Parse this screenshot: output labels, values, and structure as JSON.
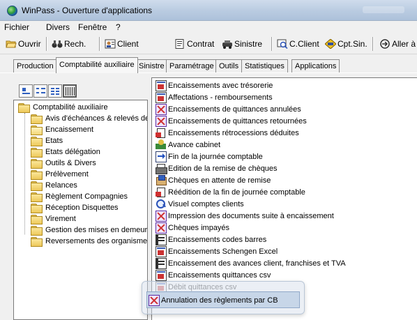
{
  "window": {
    "title": "WinPass - Ouverture d'applications"
  },
  "menu": {
    "items": [
      "Fichier",
      "Divers",
      "Fenêtre",
      "?"
    ]
  },
  "toolbar": {
    "buttons": [
      {
        "label": "Ouvrir",
        "icon": "open-folder-icon"
      },
      {
        "label": "Rech.",
        "icon": "binoculars-icon"
      },
      {
        "label": "Client",
        "icon": "client-icon"
      },
      {
        "label": "Contrat",
        "icon": "contract-icon"
      },
      {
        "label": "Sinistre",
        "icon": "claim-icon"
      },
      {
        "label": "C.Client",
        "icon": "account-client-icon"
      },
      {
        "label": "Cpt.Sin.",
        "icon": "claim-account-icon"
      },
      {
        "label": "Aller à",
        "icon": "goto-icon"
      }
    ]
  },
  "tabs": {
    "items": [
      "Production",
      "Comptabilité auxiliaire",
      "Sinistre",
      "Paramétrage",
      "Outils",
      "Statistiques",
      "Applications"
    ],
    "active": "Comptabilité auxiliaire"
  },
  "tree": {
    "root": "Comptabilité auxiliaire",
    "children": [
      "Avis d'échéances & relevés de",
      "Encaissement",
      "Etats",
      "Etats délégation",
      "Outils & Divers",
      "Prélèvement",
      "Relances",
      "Règlement Compagnies",
      "Réception Disquettes",
      "Virement",
      "Gestion des mises en demeure",
      "Reversements des organismes"
    ],
    "open_item": "Encaissement"
  },
  "list": {
    "items": [
      {
        "label": "Encaissements avec trésorerie",
        "icon": "frame-icon"
      },
      {
        "label": "Affectations - remboursements",
        "icon": "frame-icon"
      },
      {
        "label": "Encaissements de quittances annulées",
        "icon": "cancel-cross-icon"
      },
      {
        "label": "Encaissements de quittances retournées",
        "icon": "cancel-cross-icon"
      },
      {
        "label": "Encaissements rétrocessions déduites",
        "icon": "document-red-icon"
      },
      {
        "label": "Avance cabinet",
        "icon": "landscape-icon"
      },
      {
        "label": "Fin de la journée comptable",
        "icon": "arrow-icon"
      },
      {
        "label": "Edition de la remise de chèques",
        "icon": "printer-icon"
      },
      {
        "label": "Chèques en attente de remise",
        "icon": "stack-icon"
      },
      {
        "label": "Réédition de la fin de journée comptable",
        "icon": "document-red-icon"
      },
      {
        "label": "Visuel comptes clients",
        "icon": "magnifier-icon"
      },
      {
        "label": "Impression des documents suite à encaissement",
        "icon": "cancel-cross-icon"
      },
      {
        "label": "Chèques impayés",
        "icon": "cancel-cross-icon"
      },
      {
        "label": "Encaissements codes barres",
        "icon": "grid-icon"
      },
      {
        "label": "Encaissements Schengen Excel",
        "icon": "frame-icon"
      },
      {
        "label": "Encaissement des avances client, franchises et TVA",
        "icon": "grid-icon"
      },
      {
        "label": "Encaissements quittances csv",
        "icon": "frame-icon"
      },
      {
        "label": "Débit quittances csv",
        "icon": "frame-icon"
      }
    ],
    "highlighted": {
      "label": "Annulation des règlements par CB",
      "icon": "cancel-cross-icon"
    }
  }
}
